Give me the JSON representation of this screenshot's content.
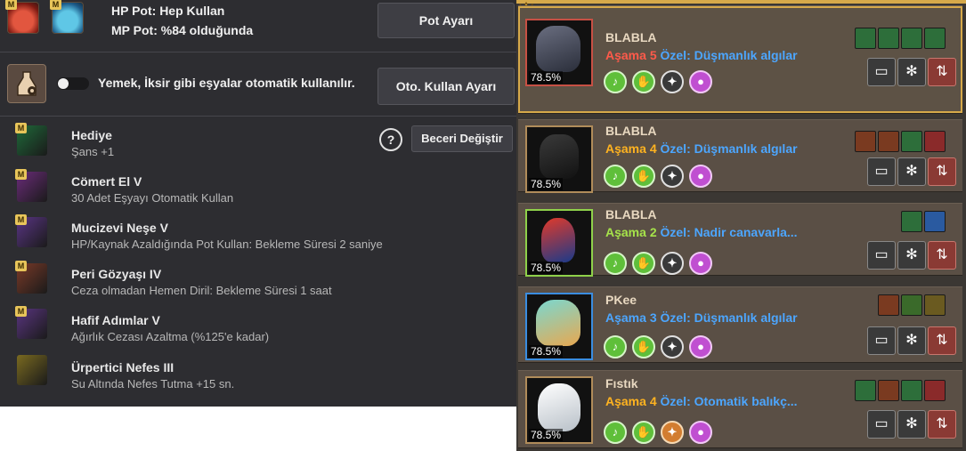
{
  "potion": {
    "hp_text": "HP Pot: Hep Kullan",
    "mp_text": "MP Pot: %84 olduğunda",
    "button": "Pot Ayarı"
  },
  "auto_use": {
    "text": "Yemek, İksir gibi eşyalar otomatik kullanılır.",
    "button": "Oto. Kullan Ayarı"
  },
  "help_symbol": "?",
  "change_skill_button": "Beceri Değiştir",
  "badge": "M",
  "skills": [
    {
      "name": "Hediye",
      "desc": "Şans +1",
      "color": "#1f6a3a",
      "icon": "clover-icon",
      "badge": true
    },
    {
      "name": "Cömert El V",
      "desc": "30 Adet Eşyayı Otomatik Kullan",
      "color": "#6b2c7a",
      "icon": "fairy-icon",
      "badge": true
    },
    {
      "name": "Mucizevi Neşe V",
      "desc": "HP/Kaynak Azaldığında Pot Kullan: Bekleme Süresi 2 saniye",
      "color": "#5a3585",
      "icon": "potion-icon",
      "badge": true
    },
    {
      "name": "Peri Gözyaşı IV",
      "desc": "Ceza olmadan Hemen Diril: Bekleme Süresi 1 saat",
      "color": "#7a3a28",
      "icon": "revive-icon",
      "badge": true
    },
    {
      "name": "Hafif Adımlar V",
      "desc": "Ağırlık Cezası Azaltma (%125'e kadar)",
      "color": "#5a3580",
      "icon": "weight-icon",
      "badge": true
    },
    {
      "name": "Ürpertici Nefes III",
      "desc": "Su Altında Nefes Tutma +15 sn.",
      "color": "#7a6a20",
      "icon": "breath-icon",
      "badge": false
    }
  ],
  "pets": [
    {
      "name": "BLABLA",
      "stage_label": "Aşama",
      "stage": "5",
      "stage_color": "#ff5a4a",
      "trait_label": "Özel:",
      "trait": "Düşmanlık algılar",
      "percent": "78.5%",
      "frame_color": "#c75044",
      "selected": true,
      "sk_colors": [
        "#2d6e3a",
        "#2d6e3a",
        "#2d6e3a",
        "#2d6e3a"
      ]
    },
    {
      "name": "BLABLA",
      "stage_label": "Aşama",
      "stage": "4",
      "stage_color": "#ffb320",
      "trait_label": "Özel:",
      "trait": "Düşmanlık algılar",
      "percent": "78.5%",
      "frame_color": "#b08c5a",
      "selected": false,
      "sk_colors": [
        "#3a5a2a",
        "#7a3a20",
        "#2d6e3a",
        "#2a5aa0"
      ]
    },
    {
      "name": "BLABLA",
      "stage_label": "Aşama",
      "stage": "2",
      "stage_color": "#a6e34a",
      "trait_label": "Özel:",
      "trait": "Nadir canavarla...",
      "percent": "78.5%",
      "frame_color": "#8fd14a",
      "selected": false,
      "sk_colors": [
        "#2d6e3a",
        "#2a5aa0"
      ]
    },
    {
      "name": "PKee",
      "stage_label": "Aşama",
      "stage": "3",
      "stage_color": "#4ca6ff",
      "trait_label": "Özel:",
      "trait": "Düşmanlık algılar",
      "percent": "78.5%",
      "frame_color": "#3a8de0",
      "selected": false,
      "sk_colors": [
        "#7a3a20",
        "#3a6a2a",
        "#6a5a20"
      ]
    },
    {
      "name": "Fıstık",
      "stage_label": "Aşama",
      "stage": "4",
      "stage_color": "#ffb320",
      "trait_label": "Özel:",
      "trait": "Otomatik balıkç...",
      "percent": "78.5%",
      "frame_color": "#b08c5a",
      "selected": false,
      "sk_colors": [
        "#2d6e3a",
        "#7a3a20",
        "#2d6e3a",
        "#8a2a2a"
      ]
    }
  ],
  "colors": {
    "panel": "#2d2d31",
    "card": "#5a4f45",
    "gold": "#d6a94a",
    "trait": "#4ca6ff"
  }
}
